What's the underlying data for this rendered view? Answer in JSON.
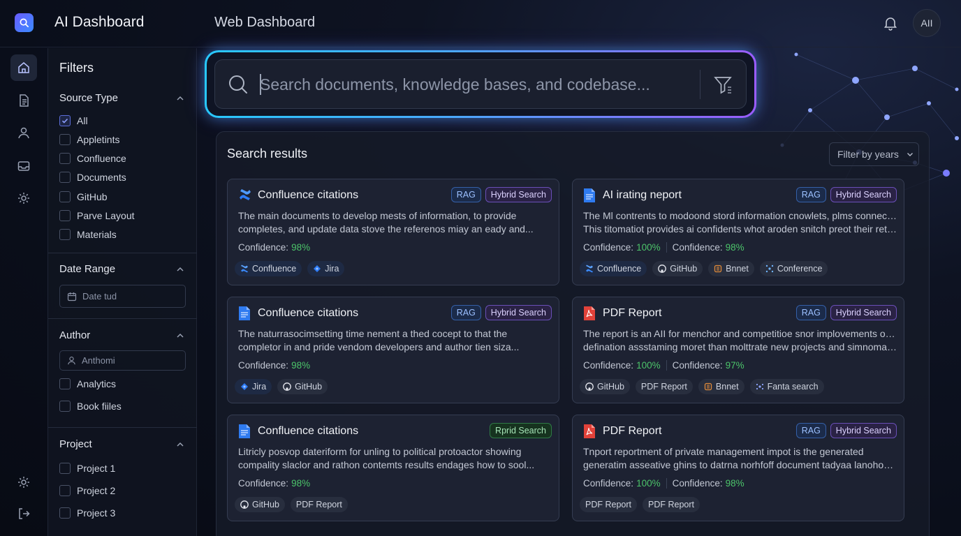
{
  "header": {
    "app_title": "AI Dashboard",
    "page_title": "Web Dashboard",
    "avatar_initials": "AII"
  },
  "filters": {
    "title": "Filters",
    "source_type": {
      "title": "Source Type",
      "options": [
        {
          "label": "All",
          "checked": true
        },
        {
          "label": "Appletints",
          "checked": false
        },
        {
          "label": "Confluence",
          "checked": false
        },
        {
          "label": "Documents",
          "checked": false
        },
        {
          "label": "GitHub",
          "checked": false
        },
        {
          "label": "Parve Layout",
          "checked": false
        },
        {
          "label": "Materials",
          "checked": false
        }
      ]
    },
    "date_range": {
      "title": "Date Range",
      "placeholder": "Date tud"
    },
    "author": {
      "title": "Author",
      "placeholder": "Anthomi",
      "options": [
        {
          "label": "Analytics",
          "checked": false
        },
        {
          "label": "Book fiiles",
          "checked": false
        }
      ]
    },
    "project": {
      "title": "Project",
      "options": [
        {
          "label": "Project 1",
          "checked": false
        },
        {
          "label": "Project 2",
          "checked": false
        },
        {
          "label": "Project 3",
          "checked": false
        }
      ]
    }
  },
  "search": {
    "placeholder": "Search documents, knowledge bases, and codebase...",
    "value": ""
  },
  "results": {
    "title": "Search results",
    "year_filter": "Filter by years",
    "cards": [
      {
        "icon": "confluence-icon",
        "title": "Confluence citations",
        "badges": [
          "RAG",
          "Hybrid Search"
        ],
        "desc": [
          "The main documents to develop mests of information, to provide",
          "completes, and update data stove the referenos miay an eady and..."
        ],
        "confidence": [
          {
            "label": "Confidence:",
            "value": "98%"
          }
        ],
        "tags": [
          "Confluence",
          "Jira"
        ]
      },
      {
        "icon": "document-icon",
        "title": "AI irating neport",
        "badges": [
          "RAG",
          "Hybrid Search"
        ],
        "desc": [
          "The Ml contrents to modoond stord information cnowlets, plms connectors.",
          "This titomatiot provides ai confidents whot aroden snitch preot their retwe..."
        ],
        "confidence": [
          {
            "label": "Confidence:",
            "value": "100%"
          },
          {
            "label": "Confidence:",
            "value": "98%"
          }
        ],
        "tags": [
          "Confluence",
          "GitHub",
          "Bnnet",
          "Conference"
        ]
      },
      {
        "icon": "document-icon",
        "title": "Confluence citations",
        "badges": [
          "RAG",
          "Hybrid Search"
        ],
        "desc": [
          "The naturrasocimsetting time nement a thed cocept to that the",
          "completor in and pride vendom developers and author tien siza..."
        ],
        "confidence": [
          {
            "label": "Confidence:",
            "value": "98%"
          }
        ],
        "tags": [
          "Jira",
          "GitHub"
        ]
      },
      {
        "icon": "pdf-icon",
        "title": "PDF Report",
        "badges": [
          "RAG",
          "Hybrid Search"
        ],
        "desc": [
          "The report is an AII for menchor and competitioe snor implovements of the",
          "defination assstaming moret than molttrate new projects and simnomation ..."
        ],
        "confidence": [
          {
            "label": "Confidence:",
            "value": "100%"
          },
          {
            "label": "Confidence:",
            "value": "97%"
          }
        ],
        "tags": [
          "GitHub",
          "PDF Report",
          "Bnnet",
          "Fanta search"
        ]
      },
      {
        "icon": "document-icon",
        "title": "Confluence citations",
        "badges": [
          "Rprid Search"
        ],
        "desc": [
          "Litricly posvop dateriform for unling to political protoactor showing",
          "compality slaclor and rathon contemts results endages how to sool..."
        ],
        "confidence": [
          {
            "label": "Confidence:",
            "value": "98%"
          }
        ],
        "tags": [
          "GitHub",
          "PDF Report"
        ]
      },
      {
        "icon": "pdf-icon",
        "title": "PDF Report",
        "badges": [
          "RAG",
          "Hybrid Search"
        ],
        "desc": [
          "Tnport reportment of private management impot is the generated",
          "generatim asseative ghins to datrna norhfoff document tadyaa lanohode..."
        ],
        "confidence": [
          {
            "label": "Confidence:",
            "value": "100%"
          },
          {
            "label": "Confidence:",
            "value": "98%"
          }
        ],
        "tags": [
          "PDF Report",
          "PDF Report"
        ]
      }
    ]
  },
  "colors": {
    "accent_cyan": "#28c8ff",
    "accent_purple": "#9a5cff",
    "confidence_green": "#4cc46a"
  }
}
